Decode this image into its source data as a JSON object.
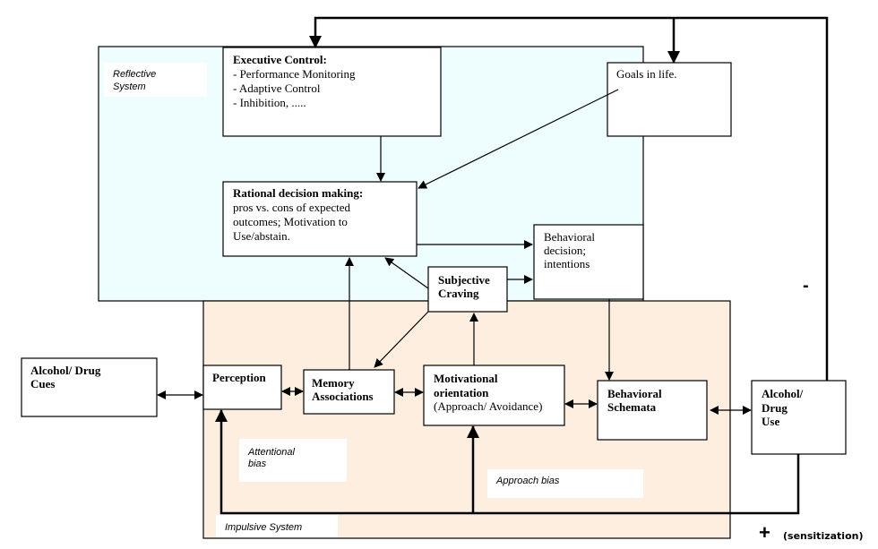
{
  "colors": {
    "reflective_bg": "#eefdfe",
    "impulsive_bg": "#fdeee0",
    "line": "#000000"
  },
  "regions": {
    "reflective_label": [
      "Reflective",
      "System"
    ],
    "impulsive_label": "Impulsive System"
  },
  "nodes": {
    "executive": {
      "title": "Executive Control:",
      "lines": [
        "- Performance Monitoring",
        "- Adaptive Control",
        "- Inhibition, ....."
      ]
    },
    "goals": {
      "title": "Goals in life."
    },
    "rational": {
      "title": "Rational decision making:",
      "lines": [
        "pros vs. cons of expected",
        "outcomes; Motivation to",
        "Use/abstain."
      ]
    },
    "behavioral_decision": {
      "lines": [
        "Behavioral",
        "decision;",
        "intentions"
      ]
    },
    "craving": {
      "lines": [
        "Subjective",
        "Craving"
      ]
    },
    "cues": {
      "lines": [
        "Alcohol/ Drug",
        "Cues"
      ]
    },
    "perception": {
      "lines": [
        "Perception"
      ]
    },
    "memory": {
      "lines": [
        "Memory",
        "Associations"
      ]
    },
    "motivational": {
      "lines": [
        "Motivational",
        "orientation"
      ],
      "sub": "(Approach/ Avoidance)"
    },
    "schemata": {
      "lines": [
        "Behavioral",
        "Schemata"
      ]
    },
    "use": {
      "lines": [
        "Alcohol/",
        "Drug",
        "Use"
      ]
    }
  },
  "annotations": {
    "attentional_bias": [
      "Attentional",
      "bias"
    ],
    "approach_bias": "Approach bias",
    "minus": "-",
    "plus": "+",
    "sensitization": "(sensitization)"
  }
}
